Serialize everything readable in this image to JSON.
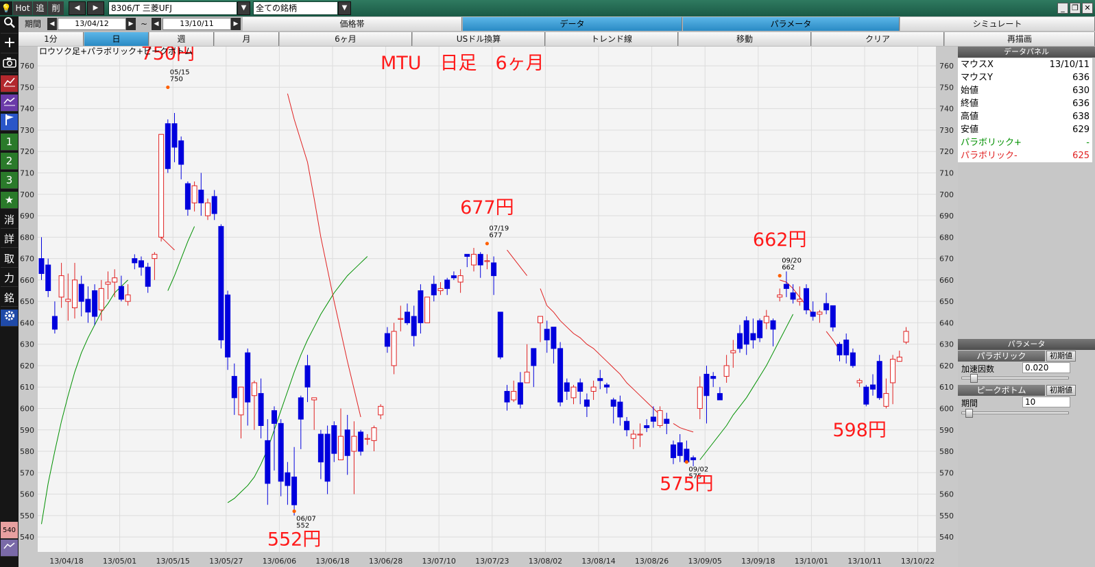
{
  "toolbar": {
    "hot": "Hot",
    "add": "追",
    "del": "削",
    "prev_icon": "◀",
    "next_icon": "▶",
    "symbol": "8306/T 三菱UFJ",
    "dropdown_icon": "▼",
    "universe": "全ての銘柄",
    "minimize": "_",
    "restore": "❐",
    "close": "✕"
  },
  "period_bar": {
    "label": "期間",
    "start_date": "13/04/12",
    "tilde": "~",
    "end_date": "13/10/11",
    "tabs": [
      "価格帯",
      "データ",
      "パラメータ",
      "シミュレート"
    ],
    "active_tab": "データ"
  },
  "timeframe_bar": {
    "buttons": [
      "1分",
      "日",
      "週",
      "月",
      "6ヶ月",
      "USドル換算",
      "トレンド線",
      "移動",
      "クリア",
      "再描画"
    ],
    "active": "日"
  },
  "left_icons": [
    "search-icon",
    "plus-icon",
    "camera-icon",
    "chart-icon",
    "chart2-icon",
    "flag-icon",
    "1",
    "2",
    "3",
    "★",
    "消",
    "詳",
    "取",
    "力",
    "銘",
    "gear-icon"
  ],
  "left_icons_bottom": [
    "540",
    "chart3-icon"
  ],
  "colors": {
    "up": "#e02020",
    "down": "#0000dd",
    "sar_plus": "#009000",
    "sar_minus": "#e02020",
    "annotation": "#ff1a1a",
    "peak_dot": "#ff6000"
  },
  "chart_data": {
    "type": "candlestick",
    "legend": "ロウソク足+パラボリック+ピークボトム",
    "title": "MTU　日足　6ヶ月",
    "ylim": [
      533,
      769
    ],
    "y_ticks": [
      540,
      550,
      560,
      570,
      580,
      590,
      600,
      610,
      620,
      630,
      640,
      650,
      660,
      670,
      680,
      690,
      700,
      710,
      720,
      730,
      740,
      750,
      760
    ],
    "x_labels": [
      "13/04/18",
      "13/05/01",
      "13/05/15",
      "13/05/27",
      "13/06/06",
      "13/06/18",
      "13/06/28",
      "13/07/10",
      "13/07/23",
      "13/08/02",
      "13/08/14",
      "13/08/26",
      "13/09/05",
      "13/09/18",
      "13/10/01",
      "13/10/11",
      "13/10/22"
    ],
    "candles": [
      [
        670,
        663,
        680,
        660
      ],
      [
        667,
        655,
        670,
        652
      ],
      [
        643,
        637,
        650,
        635
      ],
      [
        652,
        662,
        668,
        647
      ],
      [
        650,
        651,
        663,
        641
      ],
      [
        647,
        660,
        668,
        642
      ],
      [
        658,
        650,
        662,
        643
      ],
      [
        651,
        645,
        657,
        640
      ],
      [
        655,
        643,
        658,
        639
      ],
      [
        646,
        656,
        660,
        641
      ],
      [
        658,
        659,
        664,
        651
      ],
      [
        659,
        661,
        665,
        652
      ],
      [
        657,
        651,
        662,
        650
      ],
      [
        650,
        653,
        658,
        648
      ],
      [
        670,
        668,
        672,
        665
      ],
      [
        669,
        666,
        671,
        662
      ],
      [
        666,
        657,
        668,
        654
      ],
      [
        670,
        672,
        673,
        660
      ],
      [
        680,
        728,
        728,
        678
      ],
      [
        733,
        712,
        735,
        710
      ],
      [
        733,
        722,
        738,
        715
      ],
      [
        725,
        714,
        727,
        707
      ],
      [
        705,
        693,
        706,
        690
      ],
      [
        696,
        704,
        706,
        692
      ],
      [
        702,
        696,
        710,
        690
      ],
      [
        690,
        696,
        698,
        688
      ],
      [
        699,
        691,
        702,
        688
      ],
      [
        685,
        632,
        686,
        628
      ],
      [
        653,
        624,
        655,
        618
      ],
      [
        615,
        605,
        621,
        597
      ],
      [
        597,
        610,
        610,
        586
      ],
      [
        626,
        603,
        628,
        592
      ],
      [
        606,
        612,
        613,
        590
      ],
      [
        607,
        592,
        614,
        586
      ],
      [
        585,
        565,
        595,
        555
      ],
      [
        599,
        593,
        601,
        571
      ],
      [
        593,
        566,
        595,
        559
      ],
      [
        570,
        564,
        575,
        555
      ],
      [
        568,
        555,
        582,
        550
      ],
      [
        605,
        595,
        606,
        581
      ],
      [
        620,
        610,
        625,
        603
      ],
      [
        604,
        605,
        605,
        590
      ],
      [
        588,
        575,
        590,
        567
      ],
      [
        588,
        566,
        592,
        560
      ],
      [
        592,
        579,
        594,
        575
      ],
      [
        576,
        587,
        600,
        576
      ],
      [
        590,
        578,
        597,
        569
      ],
      [
        580,
        587,
        594,
        560
      ],
      [
        589,
        580,
        590,
        578
      ],
      [
        586,
        586,
        588,
        583
      ],
      [
        585,
        591,
        592,
        580
      ],
      [
        597,
        601,
        602,
        595
      ],
      [
        635,
        629,
        638,
        626
      ],
      [
        620,
        636,
        640,
        616
      ],
      [
        642,
        642,
        648,
        636
      ],
      [
        645,
        640,
        649,
        639
      ],
      [
        643,
        634,
        648,
        629
      ],
      [
        655,
        640,
        658,
        635
      ],
      [
        640,
        652,
        652,
        640
      ],
      [
        658,
        653,
        662,
        650
      ],
      [
        655,
        656,
        659,
        653
      ],
      [
        660,
        656,
        661,
        653
      ],
      [
        662,
        661,
        664,
        660
      ],
      [
        659,
        662,
        665,
        654
      ],
      [
        672,
        671,
        672,
        666
      ],
      [
        667,
        672,
        675,
        664
      ],
      [
        672,
        667,
        673,
        661
      ],
      [
        669,
        669,
        672,
        665
      ],
      [
        668,
        662,
        671,
        653
      ],
      [
        645,
        624,
        645,
        623
      ],
      [
        608,
        603,
        611,
        599
      ],
      [
        604,
        608,
        613,
        603
      ],
      [
        612,
        602,
        617,
        600
      ],
      [
        612,
        617,
        630,
        612
      ],
      [
        628,
        620,
        628,
        610
      ],
      [
        640,
        643,
        643,
        631
      ],
      [
        637,
        632,
        641,
        626
      ],
      [
        638,
        628,
        638,
        621
      ],
      [
        628,
        603,
        631,
        601
      ],
      [
        612,
        608,
        614,
        604
      ],
      [
        605,
        610,
        611,
        602
      ],
      [
        612,
        608,
        614,
        602
      ],
      [
        604,
        601,
        607,
        596
      ],
      [
        608,
        610,
        613,
        604
      ],
      [
        614,
        613,
        618,
        609
      ],
      [
        611,
        610,
        612,
        607
      ],
      [
        604,
        601,
        605,
        593
      ],
      [
        603,
        596,
        606,
        592
      ],
      [
        594,
        590,
        596,
        587
      ],
      [
        586,
        588,
        590,
        581
      ],
      [
        588,
        588,
        593,
        582
      ],
      [
        592,
        591,
        595,
        589
      ],
      [
        596,
        594,
        601,
        591
      ],
      [
        592,
        599,
        601,
        591
      ],
      [
        595,
        593,
        598,
        588
      ],
      [
        583,
        577,
        585,
        574
      ],
      [
        584,
        578,
        588,
        575
      ],
      [
        581,
        575,
        585,
        575
      ],
      [
        577,
        576,
        578,
        573
      ],
      [
        600,
        610,
        615,
        595
      ],
      [
        616,
        606,
        620,
        593
      ],
      [
        615,
        614,
        617,
        610
      ],
      [
        607,
        604,
        610,
        604
      ],
      [
        615,
        620,
        625,
        612
      ],
      [
        626,
        627,
        632,
        619
      ],
      [
        635,
        628,
        639,
        626
      ],
      [
        641,
        630,
        643,
        625
      ],
      [
        635,
        632,
        642,
        628
      ],
      [
        641,
        633,
        642,
        631
      ],
      [
        640,
        643,
        646,
        637
      ],
      [
        641,
        637,
        642,
        629
      ],
      [
        652,
        653,
        656,
        650
      ],
      [
        658,
        656,
        664,
        652
      ],
      [
        654,
        651,
        658,
        649
      ],
      [
        650,
        651,
        657,
        648
      ],
      [
        656,
        646,
        658,
        644
      ],
      [
        645,
        643,
        650,
        641
      ],
      [
        644,
        645,
        646,
        640
      ],
      [
        649,
        646,
        654,
        644
      ],
      [
        648,
        638,
        648,
        636
      ],
      [
        630,
        625,
        631,
        622
      ],
      [
        632,
        625,
        635,
        621
      ],
      [
        626,
        620,
        628,
        619
      ],
      [
        612,
        613,
        614,
        610
      ],
      [
        610,
        602,
        611,
        601
      ],
      [
        611,
        609,
        616,
        606
      ],
      [
        622,
        605,
        625,
        604
      ],
      [
        601,
        607,
        614,
        600
      ],
      [
        612,
        623,
        625,
        602
      ],
      [
        622,
        624,
        627,
        622
      ],
      [
        631,
        636,
        638,
        630
      ]
    ],
    "sar_minus": [
      [
        18,
        680
      ],
      [
        19,
        677
      ],
      [
        20,
        674
      ],
      [
        37,
        747
      ],
      [
        38,
        735
      ],
      [
        39,
        725
      ],
      [
        40,
        715
      ],
      [
        41,
        698
      ],
      [
        42,
        680
      ],
      [
        43,
        665
      ],
      [
        44,
        650
      ],
      [
        45,
        636
      ],
      [
        46,
        622
      ],
      [
        47,
        609
      ],
      [
        48,
        596
      ],
      [
        55,
        594
      ],
      [
        70,
        674
      ],
      [
        71,
        670
      ],
      [
        72,
        666
      ],
      [
        73,
        662
      ],
      [
        75,
        656
      ],
      [
        76,
        648
      ],
      [
        77,
        645
      ],
      [
        78,
        641
      ],
      [
        79,
        638
      ],
      [
        80,
        635
      ],
      [
        81,
        633
      ],
      [
        82,
        630
      ],
      [
        83,
        628
      ],
      [
        84,
        625
      ],
      [
        85,
        622
      ],
      [
        86,
        619
      ],
      [
        87,
        616
      ],
      [
        88,
        612
      ],
      [
        89,
        609
      ],
      [
        90,
        606
      ],
      [
        91,
        603
      ],
      [
        92,
        600
      ],
      [
        93,
        597
      ],
      [
        95,
        593
      ],
      [
        96,
        591
      ],
      [
        97,
        590
      ],
      [
        98,
        589
      ],
      [
        111,
        660
      ],
      [
        112,
        659
      ],
      [
        113,
        656
      ],
      [
        114,
        652
      ],
      [
        115,
        648
      ],
      [
        116,
        644
      ],
      [
        118,
        636
      ],
      [
        119,
        632
      ],
      [
        120,
        627
      ]
    ],
    "sar_plus": [
      [
        0,
        546
      ],
      [
        1,
        565
      ],
      [
        2,
        580
      ],
      [
        3,
        594
      ],
      [
        4,
        606
      ],
      [
        5,
        617
      ],
      [
        6,
        626
      ],
      [
        7,
        633
      ],
      [
        8,
        639
      ],
      [
        9,
        645
      ],
      [
        10,
        649
      ],
      [
        11,
        654
      ],
      [
        12,
        657
      ],
      [
        13,
        660
      ],
      [
        19,
        655
      ],
      [
        20,
        662
      ],
      [
        21,
        670
      ],
      [
        22,
        678
      ],
      [
        23,
        685
      ],
      [
        28,
        556
      ],
      [
        29,
        558
      ],
      [
        30,
        561
      ],
      [
        31,
        564
      ],
      [
        32,
        568
      ],
      [
        33,
        574
      ],
      [
        34,
        581
      ],
      [
        35,
        590
      ],
      [
        36,
        599
      ],
      [
        37,
        608
      ],
      [
        38,
        617
      ],
      [
        39,
        625
      ],
      [
        40,
        632
      ],
      [
        41,
        638
      ],
      [
        42,
        644
      ],
      [
        43,
        649
      ],
      [
        44,
        654
      ],
      [
        45,
        658
      ],
      [
        46,
        662
      ],
      [
        47,
        665
      ],
      [
        48,
        668
      ],
      [
        49,
        671
      ],
      [
        99,
        576
      ],
      [
        100,
        580
      ],
      [
        101,
        584
      ],
      [
        102,
        588
      ],
      [
        103,
        592
      ],
      [
        104,
        597
      ],
      [
        105,
        601
      ],
      [
        106,
        605
      ],
      [
        107,
        610
      ],
      [
        108,
        615
      ],
      [
        109,
        620
      ],
      [
        110,
        626
      ],
      [
        111,
        632
      ],
      [
        112,
        638
      ],
      [
        113,
        644
      ]
    ],
    "peaks": [
      {
        "i": 19,
        "value": 750,
        "date": "05/15",
        "kind": "peak"
      },
      {
        "i": 38,
        "value": 552,
        "date": "06/07",
        "kind": "bottom"
      },
      {
        "i": 67,
        "value": 677,
        "date": "07/19",
        "kind": "peak"
      },
      {
        "i": 97,
        "value": 575,
        "date": "09/02",
        "kind": "bottom"
      },
      {
        "i": 111,
        "value": 662,
        "date": "09/20",
        "kind": "peak"
      }
    ],
    "annotations": [
      {
        "text": "750円",
        "anchor": 19,
        "y": 763
      },
      {
        "text": "552円",
        "anchor": 38,
        "y": 536
      },
      {
        "text": "677円",
        "anchor": 67,
        "y": 691
      },
      {
        "text": "575円",
        "anchor": 97,
        "y": 562
      },
      {
        "text": "662円",
        "anchor": 111,
        "y": 676
      },
      {
        "text": "598円",
        "anchor": 123,
        "y": 587
      }
    ]
  },
  "data_panel": {
    "title": "データパネル",
    "rows": [
      {
        "key": "マウスX",
        "value": "13/10/11"
      },
      {
        "key": "マウスY",
        "value": "636"
      },
      {
        "key": "始値",
        "value": "630"
      },
      {
        "key": "終値",
        "value": "636"
      },
      {
        "key": "高値",
        "value": "638"
      },
      {
        "key": "安値",
        "value": "629"
      },
      {
        "key": "パラボリック+",
        "value": "-"
      },
      {
        "key": "パラボリック-",
        "value": "625"
      }
    ]
  },
  "param_panel": {
    "title": "パラメータ",
    "parabolic_label": "パラボリック",
    "reset_label": "初期値",
    "accel_label": "加速因数",
    "accel_value": "0.020",
    "accel_level": 0.05,
    "peak_label": "ピークボトム",
    "period_label": "期間",
    "period_value": "10",
    "period_level": 0.0
  }
}
